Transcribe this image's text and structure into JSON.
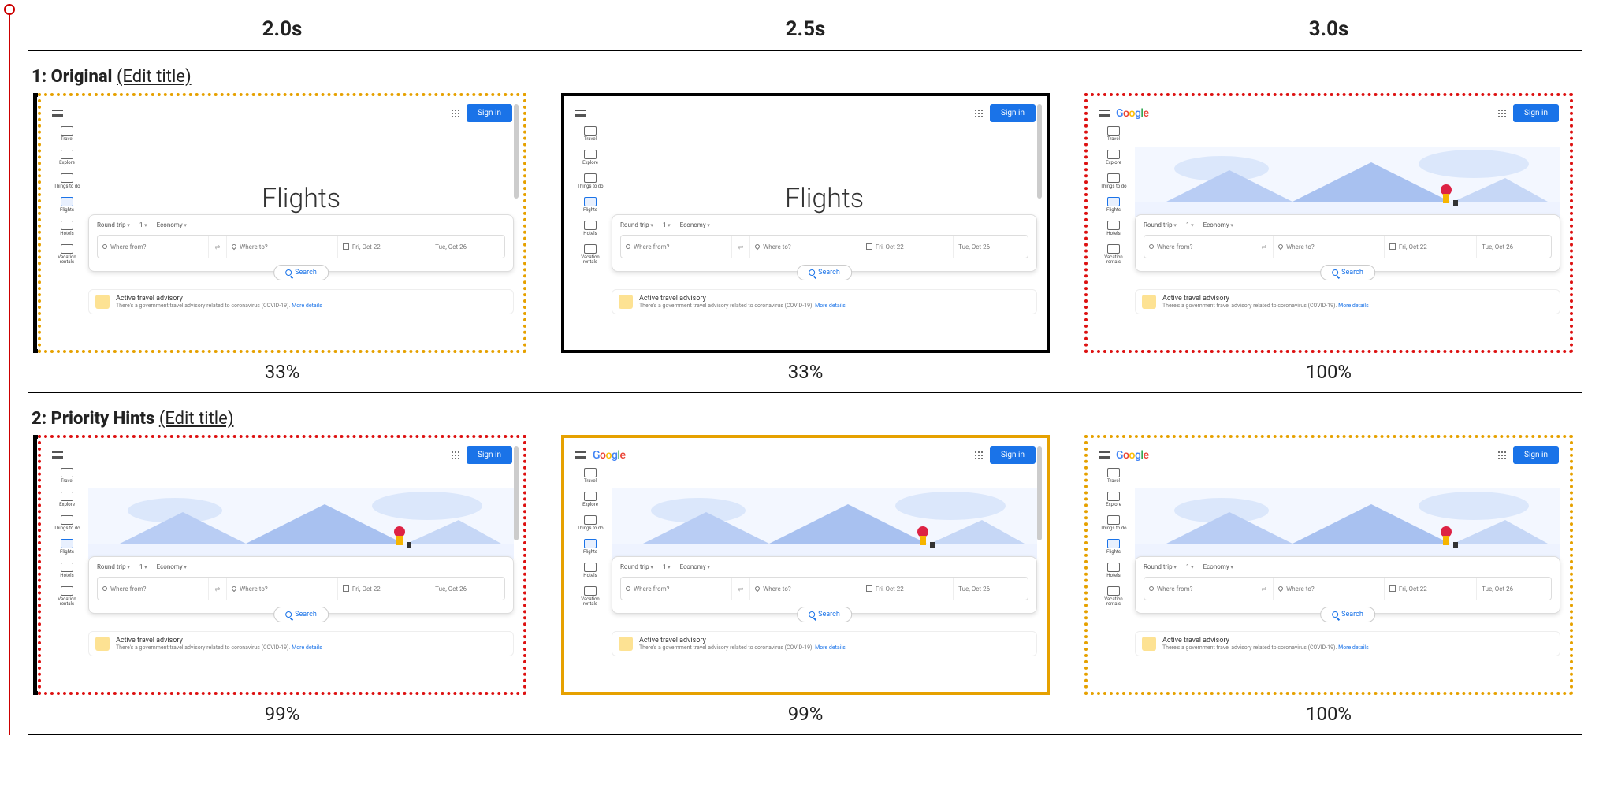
{
  "time_header": [
    "2.0s",
    "2.5s",
    "3.0s"
  ],
  "runs": [
    {
      "index": "1",
      "name": "Original",
      "edit_label": "(Edit title)",
      "frames": [
        {
          "pct": "33%",
          "border": "dotted-orange",
          "bracket": true,
          "show_hero_image": false,
          "show_logo": false,
          "show_scrollbar": true
        },
        {
          "pct": "33%",
          "border": "solid-black",
          "bracket": false,
          "show_hero_image": false,
          "show_logo": false,
          "show_scrollbar": true
        },
        {
          "pct": "100%",
          "border": "dotted-red",
          "bracket": false,
          "show_hero_image": true,
          "show_logo": true,
          "show_scrollbar": false
        }
      ]
    },
    {
      "index": "2",
      "name": "Priority Hints",
      "edit_label": "(Edit title)",
      "frames": [
        {
          "pct": "99%",
          "border": "dotted-red",
          "bracket": true,
          "show_hero_image": true,
          "show_logo": false,
          "show_scrollbar": true
        },
        {
          "pct": "99%",
          "border": "solid-orange",
          "bracket": false,
          "show_hero_image": true,
          "show_logo": true,
          "show_scrollbar": true
        },
        {
          "pct": "100%",
          "border": "dotted-orange",
          "bracket": false,
          "show_hero_image": true,
          "show_logo": true,
          "show_scrollbar": false
        }
      ]
    }
  ],
  "mini": {
    "sign_in": "Sign in",
    "logo_text": "Google",
    "title": "Flights",
    "sidebar": [
      "Travel",
      "Explore",
      "Things to do",
      "Flights",
      "Hotels",
      "Vacation rentals"
    ],
    "chips": {
      "trip": "Round trip",
      "pax": "1",
      "cabin": "Economy"
    },
    "fields": {
      "from": "Where from?",
      "to": "Where to?",
      "date1": "Fri, Oct 22",
      "date2": "Tue, Oct 26"
    },
    "search": "Search",
    "advisory": {
      "title": "Active travel advisory",
      "body": "There's a government travel advisory related to coronavirus (COVID-19).",
      "more": "More details"
    }
  }
}
